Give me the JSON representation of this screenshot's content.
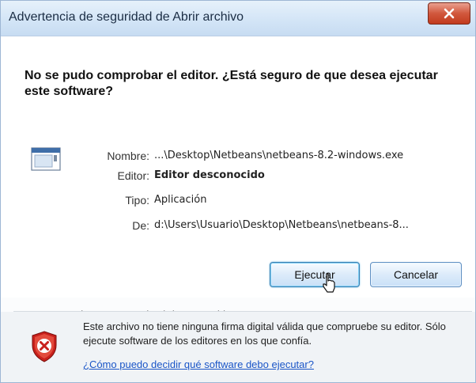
{
  "window": {
    "title": "Advertencia de seguridad de Abrir archivo",
    "close_glyph": "x"
  },
  "dialog": {
    "question": "No se pudo comprobar el editor. ¿Está seguro de que desea ejecutar este software?",
    "details": [
      {
        "label": "Nombre:",
        "value": "...\\Desktop\\Netbeans\\netbeans-8.2-windows.exe"
      },
      {
        "label": "Editor:",
        "value": "Editor desconocido"
      },
      {
        "label": "Tipo:",
        "value": "Aplicación"
      },
      {
        "label": "De:",
        "value": "d:\\Users\\Usuario\\Desktop\\Netbeans\\netbeans-8..."
      }
    ],
    "file_icon": "application-window-icon"
  },
  "buttons": {
    "run": "Ejecutar",
    "cancel": "Cancelar"
  },
  "checkbox": {
    "label": "Preguntar siempre antes de abrir este archivo",
    "checked": true
  },
  "footer": {
    "warning": "Este archivo no tiene ninguna firma digital válida que compruebe su editor. Sólo ejecute software de los editores en los que confía.",
    "link": "¿Cómo puedo decidir qué software debo ejecutar?",
    "icon": "shield-warning-icon"
  },
  "colors": {
    "link": "#1a55c7",
    "shield_red": "#c8201c",
    "close_red": "#c23b1e"
  }
}
